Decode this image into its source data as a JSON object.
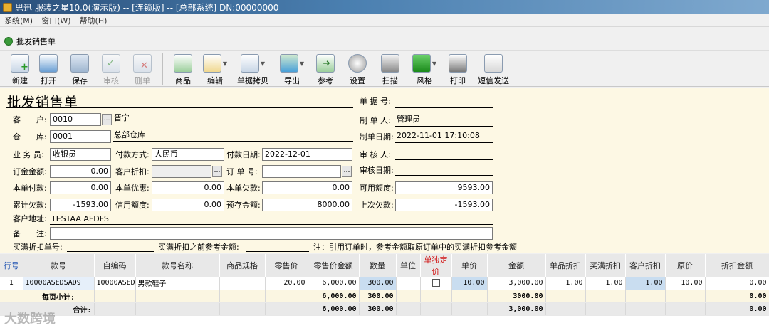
{
  "window": {
    "title": "思迅 服装之星10.0(演示版) -- [连锁版] -- [总部系统] DN:00000000"
  },
  "menu": {
    "items": [
      "系统(M)",
      "窗口(W)",
      "帮助(H)"
    ]
  },
  "doc": {
    "tab_label": "批发销售单"
  },
  "toolbar": {
    "new": "新建",
    "open": "打开",
    "save": "保存",
    "audit": "审核",
    "delete": "删单",
    "product": "商品",
    "edit": "编辑",
    "copy": "单据拷贝",
    "export": "导出",
    "reference": "参考",
    "settings": "设置",
    "scan": "扫描",
    "style": "风格",
    "print": "打印",
    "sms": "短信发送"
  },
  "form": {
    "title": "批发销售单",
    "customer_label": "客　　户:",
    "customer_code": "0010",
    "customer_name": "晋宁",
    "warehouse_label": "仓　　库:",
    "warehouse_code": "0001",
    "warehouse_name": "总部仓库",
    "salesman_label": "业 务 员:",
    "salesman": "收银员",
    "pay_method_label": "付款方式:",
    "pay_method": "人民币",
    "pay_date_label": "付款日期:",
    "pay_date": "2022-12-01",
    "deposit_label": "订金金额:",
    "deposit": "0.00",
    "cust_discount_label": "客户折扣:",
    "cust_discount": "",
    "order_no_label": "订 单 号:",
    "order_no": "",
    "this_paid_label": "本单付款:",
    "this_paid": "0.00",
    "this_discount_label": "本单优惠:",
    "this_discount": "0.00",
    "this_owe_label": "本单欠款:",
    "this_owe": "0.00",
    "available_label": "可用额度:",
    "available": "9593.00",
    "cum_owe_label": "累计欠款:",
    "cum_owe": "-1593.00",
    "credit_label": "信用额度:",
    "credit": "0.00",
    "prestore_label": "预存金额:",
    "prestore": "8000.00",
    "last_owe_label": "上次欠款:",
    "last_owe": "-1593.00",
    "address_label": "客户地址:",
    "address": "TESTAA AFDFS",
    "remark_label": "备　　注:",
    "remark": "",
    "bill_no_label": "单 据 号:",
    "bill_no": "",
    "maker_label": "制 单 人:",
    "maker": "管理员",
    "make_date_label": "制单日期:",
    "make_date": "2022-11-01 17:10:08",
    "auditor_label": "审 核 人:",
    "auditor": "",
    "audit_date_label": "审核日期:",
    "audit_date": "",
    "buy_full_no_label": "买满折扣单号:",
    "buy_full_ref_label": "买满折扣之前参考金额:",
    "note": "注：引用订单时，参考金额取原订单中的买满折扣参考金额"
  },
  "grid": {
    "columns": [
      "行号",
      "款号",
      "自编码",
      "款号名称",
      "商品规格",
      "零售价",
      "零售价金额",
      "数量",
      "单位",
      "单独定价",
      "单价",
      "金额",
      "单品折扣",
      "买满折扣",
      "客户折扣",
      "原价",
      "折扣金额"
    ],
    "rows": [
      [
        "1",
        "10000ASEDSAD9",
        "10000ASEDS",
        "男款鞋子",
        "",
        "20.00",
        "6,000.00",
        "300.00",
        "",
        "",
        "10.00",
        "3,000.00",
        "1.00",
        "1.00",
        "1.00",
        "10.00",
        "0.00"
      ]
    ],
    "subtotal": {
      "label": "每页小计:",
      "retail_amount": "6,000.00",
      "qty": "300.00",
      "amount": "3000.00",
      "discount_amount": "0.00"
    },
    "total": {
      "label": "合计:",
      "retail_amount": "6,000.00",
      "qty": "300.00",
      "amount": "3,000.00",
      "discount_amount": "0.00"
    }
  },
  "watermark": "大数跨境"
}
